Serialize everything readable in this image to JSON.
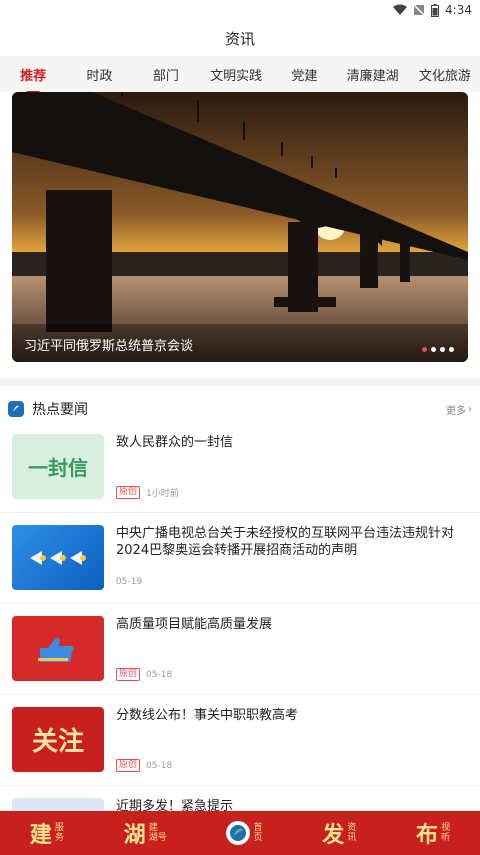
{
  "status_bar": {
    "time": "4:34"
  },
  "header": {
    "title": "资讯"
  },
  "tabs": [
    {
      "label": "推荐",
      "active": true
    },
    {
      "label": "时政"
    },
    {
      "label": "部门"
    },
    {
      "label": "文明实践"
    },
    {
      "label": "党建"
    },
    {
      "label": "清廉建湖"
    },
    {
      "label": "文化旅游"
    }
  ],
  "banner": {
    "caption": "习近平同俄罗斯总统普京会谈",
    "dots_total": 4,
    "dot_active": 1
  },
  "section": {
    "title": "热点要闻",
    "more": "更多"
  },
  "news": [
    {
      "thumb_text": "一封信",
      "title": "致人民群众的一封信",
      "badge": "原创",
      "time": "1小时前"
    },
    {
      "thumb_text": "",
      "title": "中央广播电视总台关于未经授权的互联网平台违法违规针对2024巴黎奥运会转播开展招商活动的声明",
      "badge": "",
      "time": "05-19"
    },
    {
      "thumb_text": "",
      "title": "高质量项目赋能高质量发展",
      "badge": "原创",
      "time": "05-18"
    },
    {
      "thumb_text": "关注",
      "title": "分数线公布！事关中职职教高考",
      "badge": "原创",
      "time": "05-18"
    },
    {
      "thumb_text": "",
      "title": "近期多发！紧急提示",
      "badge": "",
      "time": ""
    }
  ],
  "bottom_nav": [
    {
      "big": "建",
      "small1": "服",
      "small2": "务"
    },
    {
      "big": "湖",
      "small1": "建",
      "small2": "湖号"
    },
    {
      "big": "",
      "small1": "首",
      "small2": "页"
    },
    {
      "big": "发",
      "small1": "资",
      "small2": "讯"
    },
    {
      "big": "布",
      "small1": "视",
      "small2": "听"
    }
  ],
  "colors": {
    "accent": "#d6201f",
    "nav_bg": "#c8201e",
    "nav_text": "#ffe38a"
  }
}
